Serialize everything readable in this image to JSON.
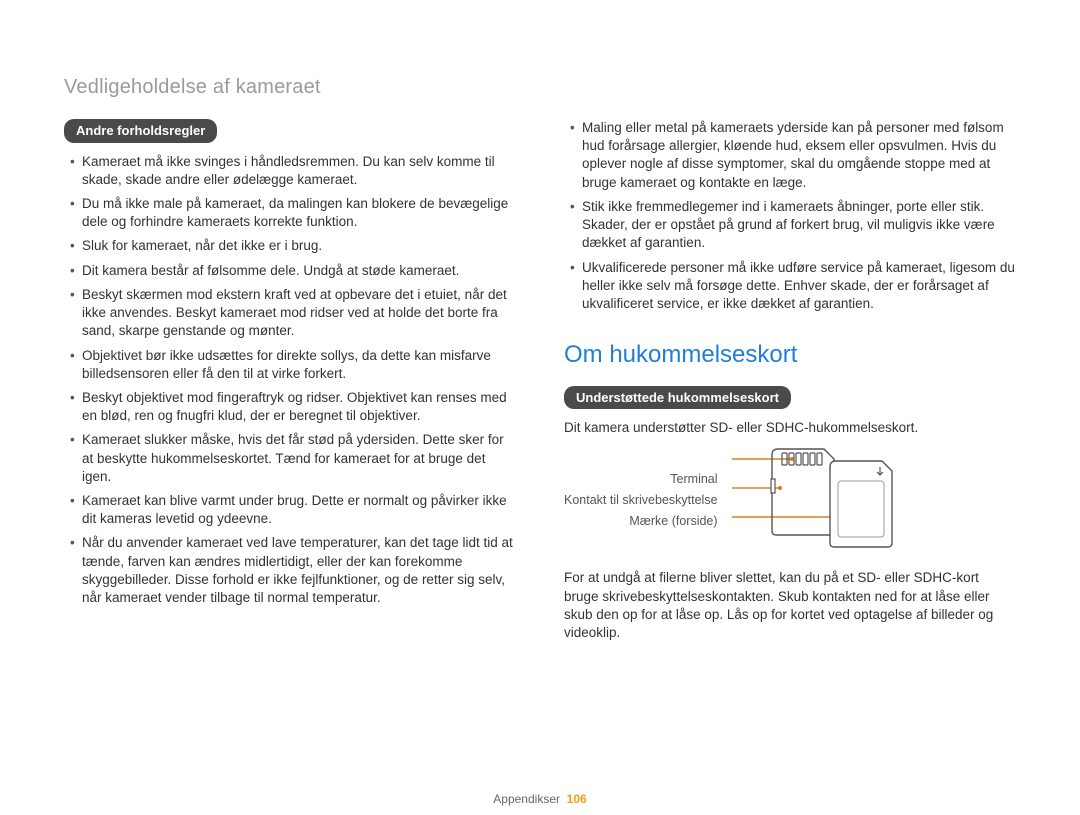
{
  "pageTitle": "Vedligeholdelse af kameraet",
  "left": {
    "pill": "Andre forholdsregler",
    "items": [
      "Kameraet må ikke svinges i håndledsremmen. Du kan selv komme til skade, skade andre eller ødelægge kameraet.",
      "Du må ikke male på kameraet, da malingen kan blokere de bevægelige dele og forhindre kameraets korrekte funktion.",
      "Sluk for kameraet, når det ikke er i brug.",
      "Dit kamera består af følsomme dele. Undgå at støde kameraet.",
      "Beskyt skærmen mod ekstern kraft ved at opbevare det i etuiet, når det ikke anvendes. Beskyt kameraet mod ridser ved at holde det borte fra sand, skarpe genstande og mønter.",
      "Objektivet bør ikke udsættes for direkte sollys, da dette kan misfarve billedsensoren eller få den til at virke forkert.",
      "Beskyt objektivet mod fingeraftryk og ridser. Objektivet kan renses med en blød, ren og fnugfri klud, der er beregnet til objektiver.",
      "Kameraet slukker måske, hvis det får stød på ydersiden. Dette sker for at beskytte hukommelseskortet. Tænd for kameraet for at bruge det igen.",
      "Kameraet kan blive varmt under brug. Dette er normalt og påvirker ikke dit kameras levetid og ydeevne.",
      "Når du anvender kameraet ved lave temperaturer, kan det tage lidt tid at tænde, farven kan ændres midlertidigt, eller der kan forekomme skyggebilleder. Disse forhold er ikke fejlfunktioner, og de retter sig selv, når kameraet vender tilbage til normal temperatur."
    ]
  },
  "right": {
    "topItems": [
      "Maling eller metal på kameraets yderside kan på personer med følsom hud forårsage allergier, kløende hud, eksem eller opsvulmen. Hvis du oplever nogle af disse symptomer, skal du omgående stoppe med at bruge kameraet og kontakte en læge.",
      "Stik ikke fremmedlegemer ind i kameraets åbninger, porte eller stik. Skader, der er opstået på grund af forkert brug, vil muligvis ikke være dækket af garantien.",
      "Ukvalificerede personer må ikke udføre service på kameraet, ligesom du heller ikke selv må forsøge dette. Enhver skade, der er forårsaget af ukvalificeret service, er ikke dækket af garantien."
    ],
    "sectionHeading": "Om hukommelseskort",
    "pill": "Understøttede hukommelseskort",
    "intro": "Dit kamera understøtter SD- eller SDHC-hukommelseskort.",
    "labels": {
      "terminal": "Terminal",
      "writeProtect": "Kontakt til skrivebeskyttelse",
      "labelFront": "Mærke (forside)"
    },
    "after": "For at undgå at filerne bliver slettet, kan du på et SD- eller SDHC-kort bruge skrivebeskyttelseskontakten. Skub kontakten ned for at låse eller skub den op for at låse op. Lås op for kortet ved optagelse af billeder og videoklip."
  },
  "footer": {
    "section": "Appendikser",
    "page": "106"
  }
}
